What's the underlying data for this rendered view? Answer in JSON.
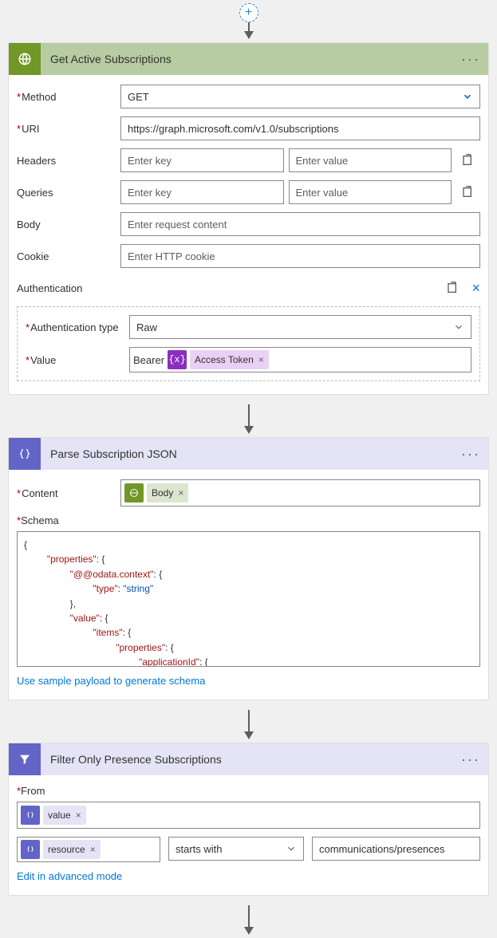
{
  "add_button": "+",
  "step1": {
    "title": "Get Active Subscriptions",
    "method_label": "Method",
    "method_value": "GET",
    "uri_label": "URI",
    "uri_value": "https://graph.microsoft.com/v1.0/subscriptions",
    "headers_label": "Headers",
    "headers_key_ph": "Enter key",
    "headers_val_ph": "Enter value",
    "queries_label": "Queries",
    "queries_key_ph": "Enter key",
    "queries_val_ph": "Enter value",
    "body_label": "Body",
    "body_ph": "Enter request content",
    "cookie_label": "Cookie",
    "cookie_ph": "Enter HTTP cookie",
    "auth_label": "Authentication",
    "auth_type_label": "Authentication type",
    "auth_type_value": "Raw",
    "value_label": "Value",
    "bearer_text": "Bearer",
    "token_icon": "{x}",
    "token_label": "Access Token",
    "close_x": "×"
  },
  "step2": {
    "title": "Parse Subscription JSON",
    "content_label": "Content",
    "body_pill": "Body",
    "schema_label": "Schema",
    "sample_link": "Use sample payload to generate schema",
    "schema": {
      "l1": "{",
      "properties": "\"properties\"",
      "odata": "\"@@odata.context\"",
      "type": "\"type\"",
      "string": "\"string\"",
      "value": "\"value\"",
      "items": "\"items\"",
      "appid": "\"applicationId\""
    }
  },
  "step3": {
    "title": "Filter Only Presence Subscriptions",
    "from_label": "From",
    "value_pill": "value",
    "resource_pill": "resource",
    "op": "starts with",
    "rhs": "communications/presences",
    "adv_link": "Edit in advanced mode"
  }
}
